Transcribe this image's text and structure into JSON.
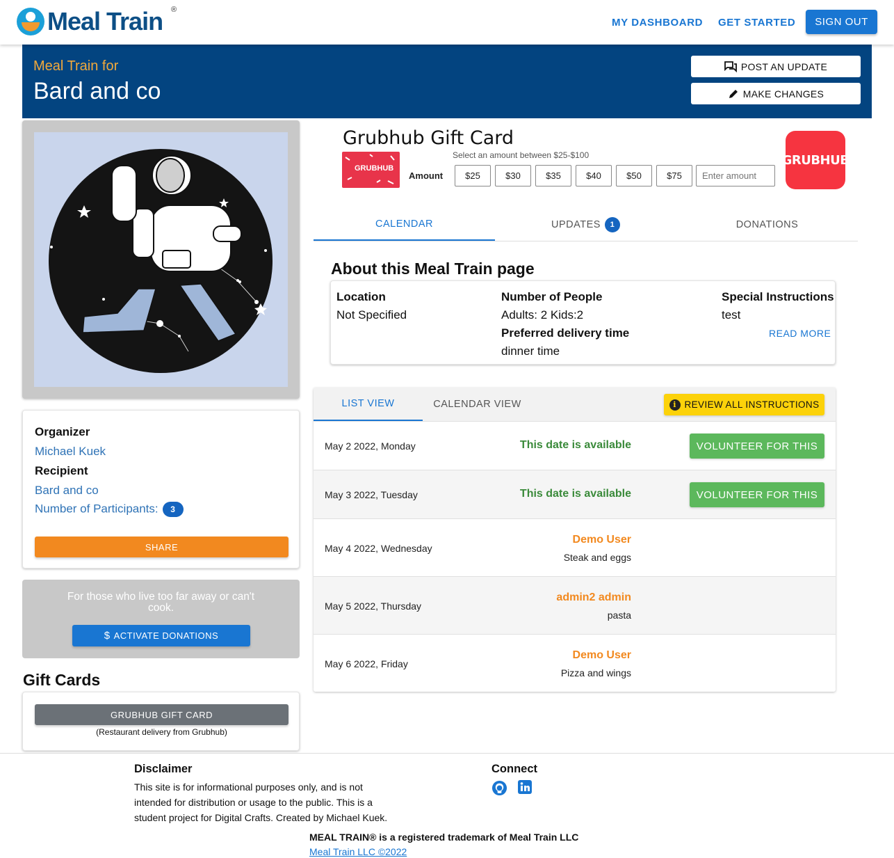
{
  "brand": {
    "name": "Meal Train",
    "reg": "®"
  },
  "nav": {
    "dashboard": "MY DASHBOARD",
    "get_started": "GET STARTED",
    "sign_out": "SIGN OUT"
  },
  "banner": {
    "subtitle": "Meal Train for",
    "title": "Bard and co",
    "post_update": "POST AN UPDATE",
    "make_changes": "MAKE CHANGES"
  },
  "profile": {
    "organizer_label": "Organizer",
    "organizer": "Michael Kuek",
    "recipient_label": "Recipient",
    "recipient": "Bard and co",
    "participants_label": "Number of Participants:",
    "participants_count": "3",
    "share": "SHARE"
  },
  "donate": {
    "text": "For those who live too far away or can't cook.",
    "button": "ACTIVATE DONATIONS"
  },
  "gift_cards": {
    "heading": "Gift Cards",
    "button": "GRUBHUB GIFT CARD",
    "subtitle": "(Restaurant delivery from Grubhub)"
  },
  "grubhub_widget": {
    "title": "Grubhub Gift Card",
    "card_text": "GRUBHUB",
    "hint": "Select an amount between $25-$100",
    "amount_label": "Amount",
    "amounts": [
      "$25",
      "$30",
      "$35",
      "$40",
      "$50",
      "$75"
    ],
    "placeholder": "Enter amount",
    "logo_text": "GRUBHUB"
  },
  "tabs": {
    "calendar": "CALENDAR",
    "updates": "UPDATES",
    "updates_count": "1",
    "donations": "DONATIONS"
  },
  "about": {
    "title": "About this Meal Train page",
    "location_label": "Location",
    "location": "Not Specified",
    "people_label": "Number of People",
    "people": "Adults: 2 Kids:2",
    "delivery_label": "Preferred delivery time",
    "delivery": "dinner time",
    "instructions_label": "Special Instructions",
    "instructions": "test",
    "read_more": "READ MORE"
  },
  "list": {
    "list_view": "LIST VIEW",
    "calendar_view": "CALENDAR VIEW",
    "review": "REVIEW ALL INSTRUCTIONS",
    "rows": [
      {
        "date": "May 2 2022, Monday",
        "status": "This date is available",
        "action": "VOLUNTEER FOR THIS"
      },
      {
        "date": "May 3 2022, Tuesday",
        "status": "This date is available",
        "action": "VOLUNTEER FOR THIS"
      },
      {
        "date": "May 4 2022, Wednesday",
        "name": "Demo User",
        "meal": "Steak and eggs"
      },
      {
        "date": "May 5 2022, Thursday",
        "name": "admin2 admin",
        "meal": "pasta"
      },
      {
        "date": "May 6 2022, Friday",
        "name": "Demo User",
        "meal": "Pizza and wings"
      }
    ]
  },
  "footer": {
    "disclaimer_heading": "Disclaimer",
    "disclaimer": "This site is for informational purposes only, and is not intended for distribution or usage to the public. This is a student project for Digital Crafts. Created by Michael Kuek.",
    "connect_heading": "Connect",
    "trademark": "MEAL TRAIN® is a registered trademark of Meal Train LLC",
    "copyright": "Meal Train LLC ©2022"
  },
  "colors": {
    "banner": "#034480",
    "accent": "#1976d2",
    "orange": "#f2891f",
    "available": "#3a8a3a",
    "volunteer": "#5cb85c",
    "review": "#fcd20a",
    "grubhub": "#f63440"
  }
}
